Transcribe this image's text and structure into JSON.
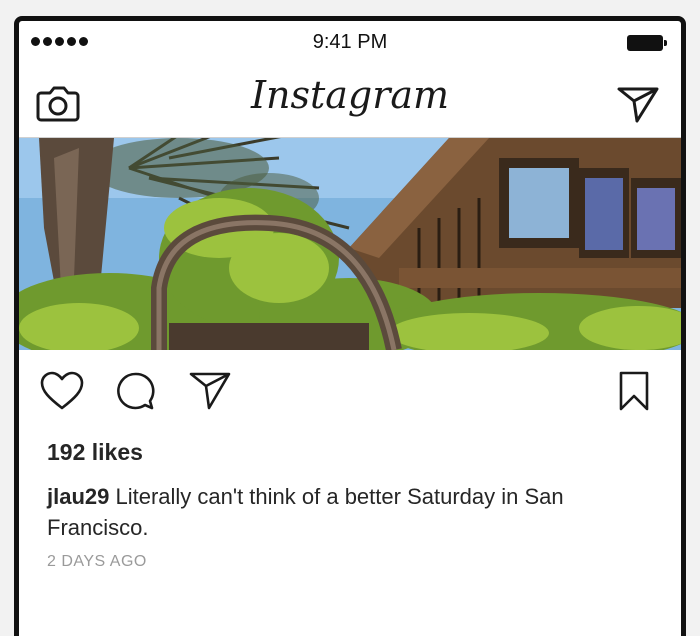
{
  "status_bar": {
    "time": "9:41 PM",
    "signal_dots": 5
  },
  "nav": {
    "logo": "Instagram",
    "left_icon": "camera-icon",
    "right_icon": "paper-plane-icon"
  },
  "post": {
    "photo_description": "tree-house-garden-photo",
    "actions": {
      "like_icon": "heart-icon",
      "comment_icon": "comment-bubble-icon",
      "share_icon": "paper-plane-icon",
      "save_icon": "bookmark-icon"
    },
    "likes": "192 likes",
    "caption_user": "jlau29",
    "caption_text": " Literally can't think of a better Saturday in San Francisco.",
    "timestamp": "2 DAYS AGO"
  },
  "colors": {
    "text": "#262626",
    "muted": "#9a9a9a",
    "frame": "#111111"
  }
}
